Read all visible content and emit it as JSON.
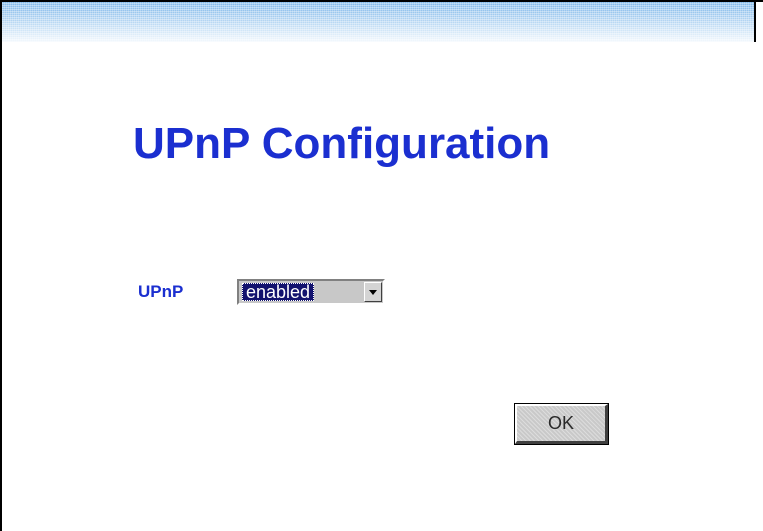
{
  "page": {
    "title": "UPnP Configuration"
  },
  "form": {
    "upnp_label": "UPnP",
    "upnp_select": {
      "selected": "enabled",
      "options": [
        "enabled"
      ]
    },
    "ok_label": "OK"
  },
  "icons": {
    "dropdown_arrow": "chevron-down-icon"
  },
  "colors": {
    "title": "#1b2fd0",
    "label": "#1b2fd0",
    "select_highlight": "#12126e",
    "top_band": "#a6cdf0",
    "button_face": "#c9c9c9"
  }
}
